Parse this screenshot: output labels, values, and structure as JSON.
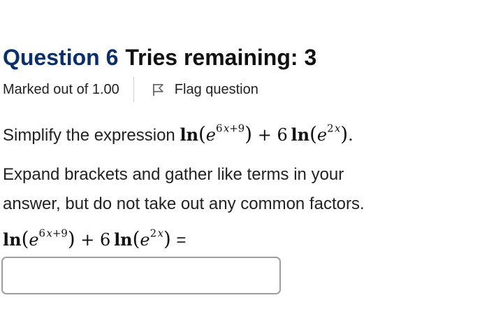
{
  "question": {
    "label": "Question 6",
    "tries": "Tries remaining: 3"
  },
  "info": {
    "marked": "Marked out of 1.00",
    "flag_label": "Flag question"
  },
  "prompt": {
    "intro": "Simplify the expression",
    "end_period": ".",
    "instruction_line1": "Expand brackets and gather like terms in your",
    "instruction_line2": "answer, but do not take out any common factors.",
    "equals": "="
  },
  "expression": {
    "ln": "ln",
    "e": "e",
    "exp1_coef": "6",
    "exp1_var": "x",
    "exp1_tail": "+9",
    "plus": "+",
    "coef": "6",
    "exp2_coef": "2",
    "exp2_var": "x"
  },
  "answer": {
    "value": "",
    "placeholder": ""
  },
  "colors": {
    "question_label": "#0a2f6b",
    "input_border": "#9e9e9e"
  },
  "icons": {
    "flag": "flag-icon"
  }
}
